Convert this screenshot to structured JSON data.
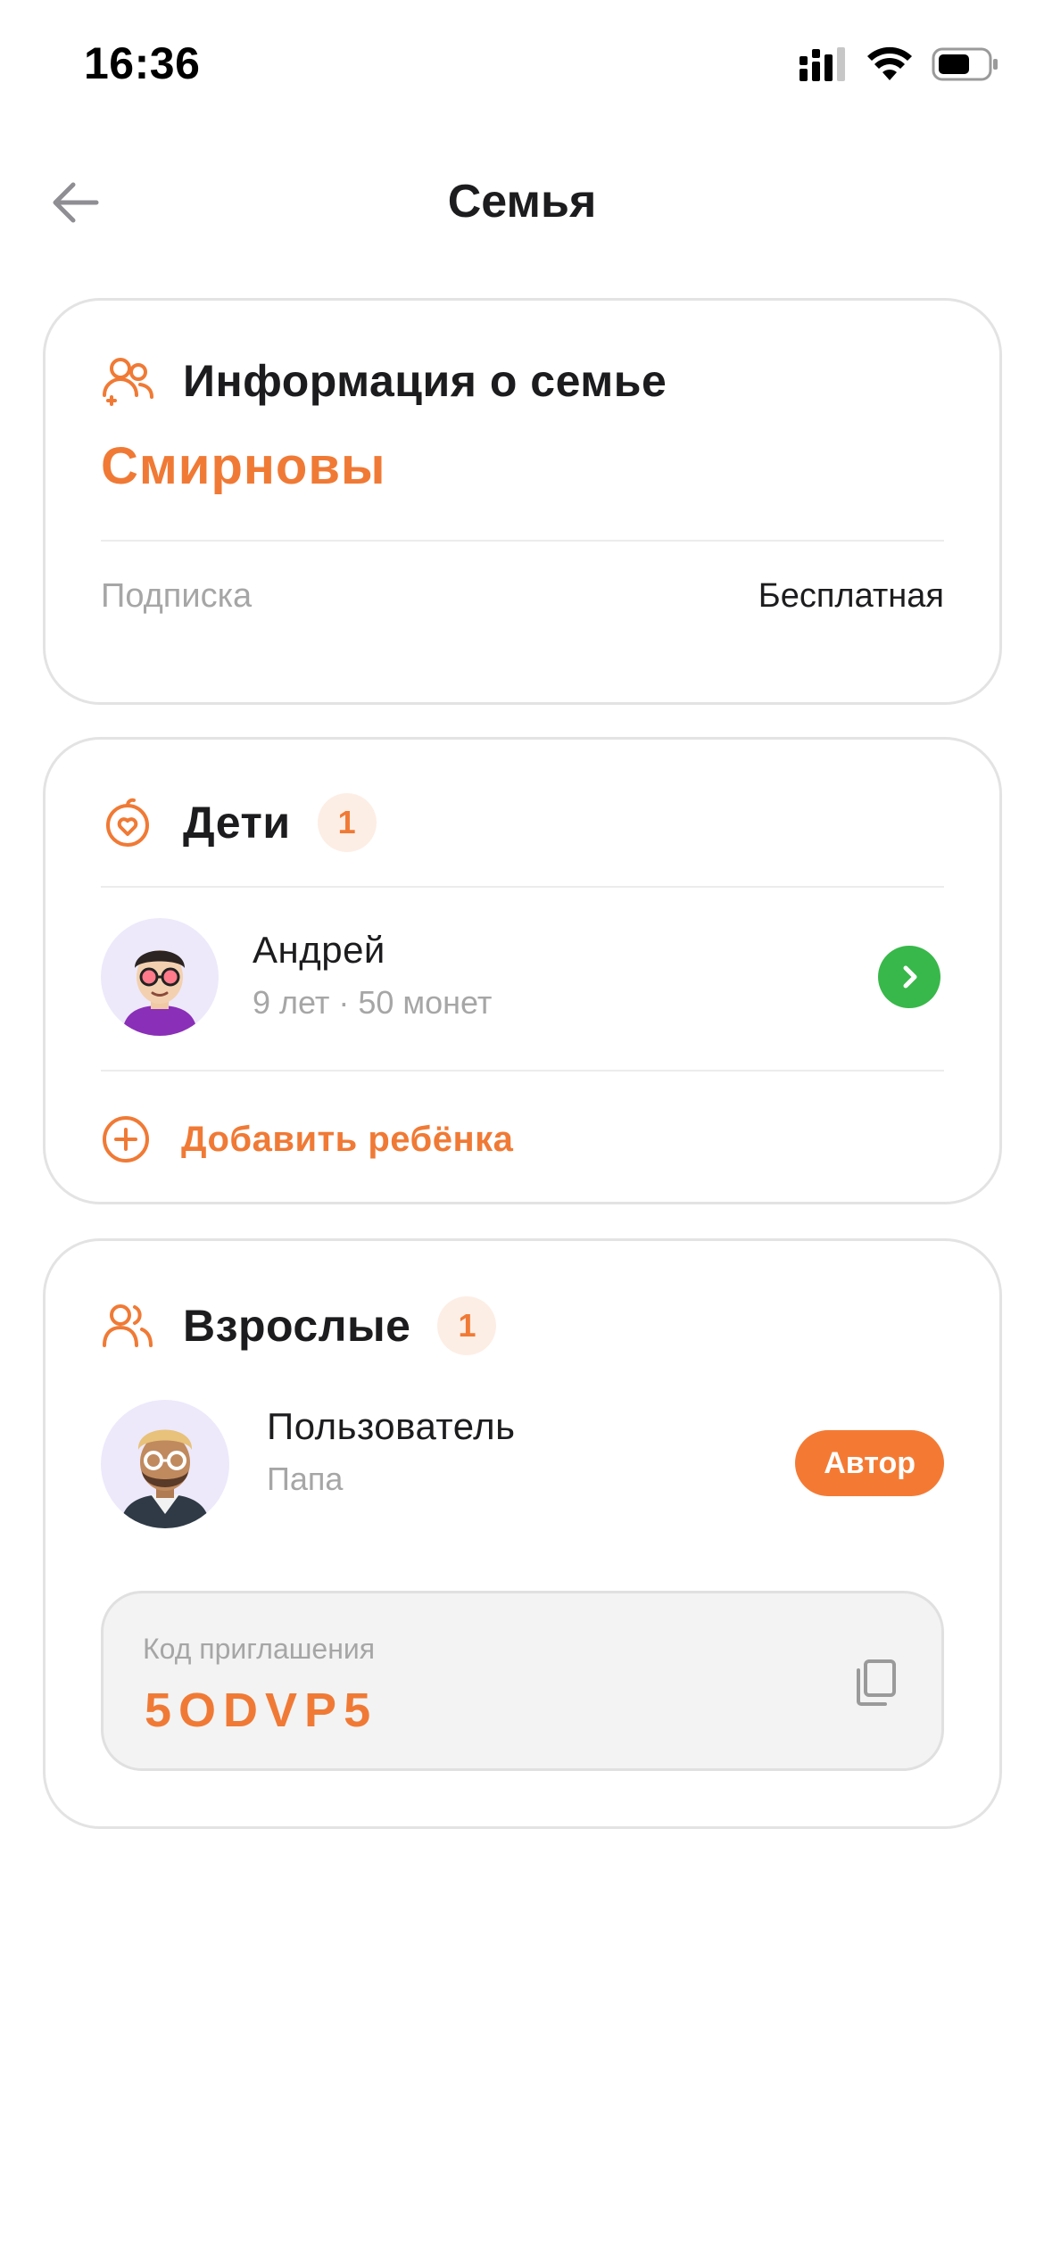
{
  "status_bar": {
    "time": "16:36"
  },
  "header": {
    "title": "Семья"
  },
  "family_info": {
    "title": "Информация о семье",
    "family_name": "Смирновы",
    "subscription_label": "Подписка",
    "subscription_value": "Бесплатная"
  },
  "children": {
    "title": "Дети",
    "count": "1",
    "items": [
      {
        "name": "Андрей",
        "details": "9 лет · 50 монет"
      }
    ],
    "add_label": "Добавить ребёнка"
  },
  "adults": {
    "title": "Взрослые",
    "count": "1",
    "items": [
      {
        "name": "Пользователь",
        "role_label": "Папа",
        "badge": "Автор"
      }
    ],
    "invite_label": "Код приглашения",
    "invite_code": "5ODVP5"
  },
  "colors": {
    "accent": "#f07a35",
    "badge_bg": "#fdeee5",
    "go_button": "#38b84a",
    "avatar_bg": "#ede9fb"
  }
}
